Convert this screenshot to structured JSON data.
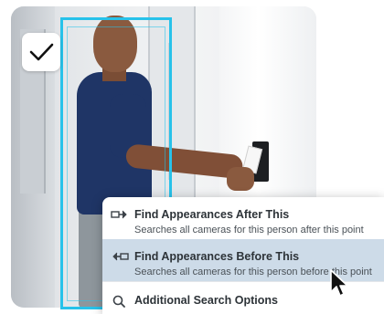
{
  "menu": {
    "items": [
      {
        "title": "Find Appearances After This",
        "description": "Searches all cameras for this person after this point",
        "icon": "arrow-right-stop-icon"
      },
      {
        "title": "Find Appearances Before This",
        "description": "Searches all cameras for this person before this point",
        "icon": "arrow-left-stop-icon"
      },
      {
        "title": "Additional Search Options",
        "icon": "search-icon"
      }
    ]
  },
  "overlay": {
    "checkbox_icon": "checkmark-icon",
    "detection_color": "#27c2ea",
    "highlight_color": "#cddbe8"
  }
}
